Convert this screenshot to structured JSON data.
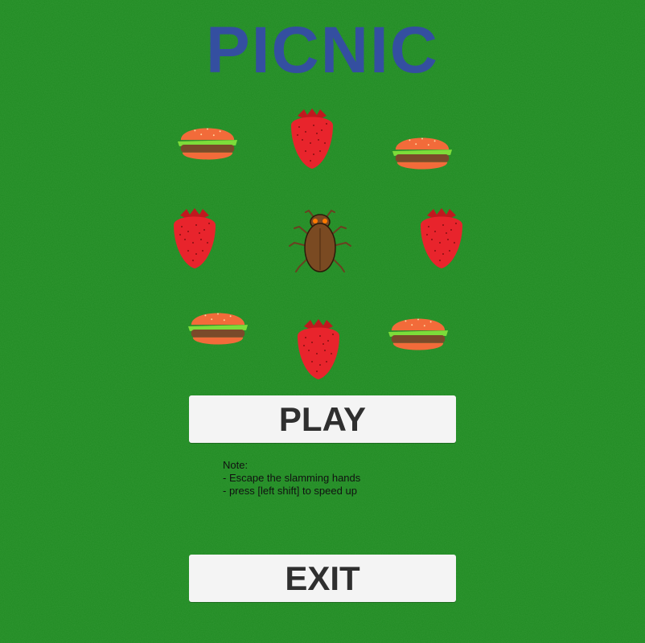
{
  "title": "PICNIC",
  "buttons": {
    "play_label": "PLAY",
    "exit_label": "EXIT"
  },
  "note": {
    "heading": "Note:",
    "lines": [
      "- Escape the slamming hands",
      "- press [left shift] to speed up"
    ]
  },
  "colors": {
    "background": "#1f8a22",
    "title": "#344fa0",
    "button_bg": "#f4f4f4",
    "button_text": "#2f2f2f",
    "strawberry": "#e8242c",
    "bun": "#f26b3a",
    "lettuce": "#7ddc3a",
    "patty": "#7a4a2a",
    "bug": "#7a4a22"
  },
  "sprites": [
    "burger-icon",
    "strawberry-icon",
    "burger-icon",
    "strawberry-icon",
    "bug-icon",
    "strawberry-icon",
    "burger-icon",
    "strawberry-icon",
    "burger-icon"
  ]
}
